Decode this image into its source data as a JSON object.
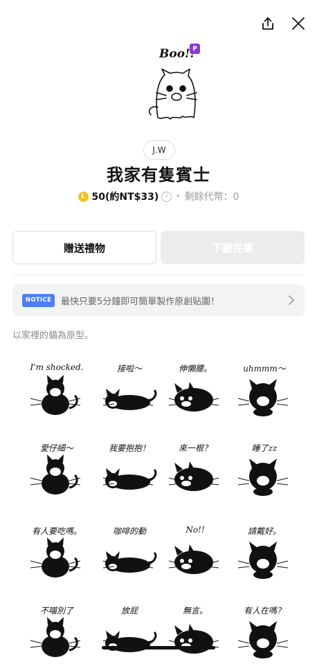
{
  "header": {
    "share_icon": "share-icon",
    "close_icon": "close-icon"
  },
  "product": {
    "premium_badge": "P",
    "hero_caption": "Boo!!",
    "author": "J.W",
    "title": "我家有隻賓士",
    "coin_letter": "L",
    "price": "50(約NT$33)",
    "info_symbol": "i",
    "separator": "•",
    "balance": "剩餘代幣：0"
  },
  "actions": {
    "gift_label": "贈送禮物",
    "download_label": "下載完畢"
  },
  "notice": {
    "badge": "NOTICE",
    "text": "最快只要5分鐘即可簡單製作原創貼圖！"
  },
  "description": "以家裡的貓為原型。",
  "stickers": [
    {
      "caption": "I'm shocked."
    },
    {
      "caption": "接啦～"
    },
    {
      "caption": "伸懶腰。"
    },
    {
      "caption": "uhmmm～"
    },
    {
      "caption": "愛仔細～"
    },
    {
      "caption": "我要抱抱！"
    },
    {
      "caption": "來一根？"
    },
    {
      "caption": "睡了zz"
    },
    {
      "caption": "有人要吃嗎。"
    },
    {
      "caption": "咖啡的動"
    },
    {
      "caption": "No!!"
    },
    {
      "caption": "請戴好。"
    },
    {
      "caption": "不喵別了"
    },
    {
      "caption": "放屁"
    },
    {
      "caption": "無言。"
    },
    {
      "caption": "有人在嗎？"
    }
  ],
  "colors": {
    "accent_purple": "#8f39c9",
    "coin_yellow": "#f4c21a",
    "notice_blue": "#4d7ff0",
    "disabled_gray": "#ececec"
  }
}
